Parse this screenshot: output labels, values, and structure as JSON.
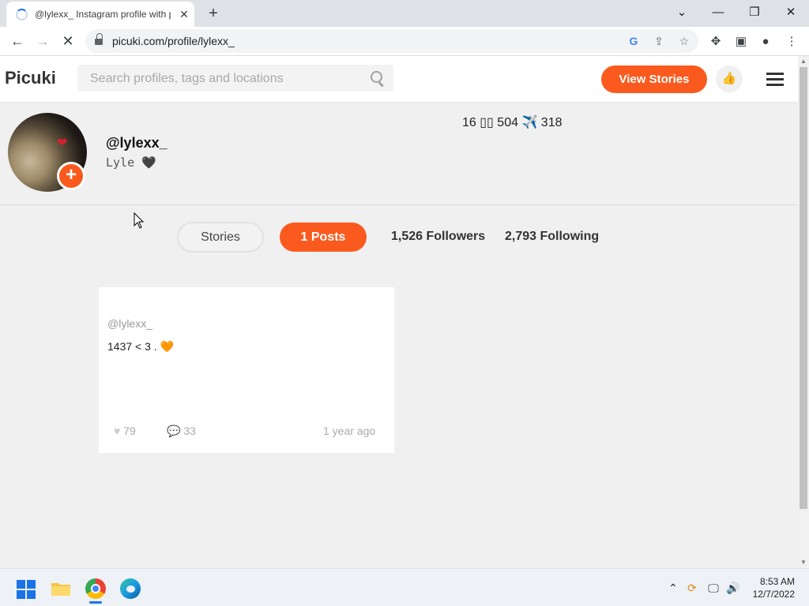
{
  "browser": {
    "tab_title": "@lylexx_ Instagram profile with p",
    "url": "picuki.com/profile/lylexx_",
    "new_tab_symbol": "+",
    "tab_close_symbol": "✕",
    "back_symbol": "←",
    "forward_symbol": "→",
    "stop_symbol": "✕"
  },
  "site": {
    "logo": "Picuki",
    "search_placeholder": "Search profiles, tags and locations",
    "view_stories_label": "View Stories",
    "accent_color": "#fa5a1e"
  },
  "profile": {
    "username": "@lylexx_",
    "full_name": "Lyle",
    "full_name_emoji": "🖤",
    "stats_line": "16 ▯▯ 504 ✈️ 318",
    "tabs": {
      "stories": "Stories",
      "posts": "1 Posts",
      "followers": "1,526 Followers",
      "following": "2,793 Following"
    }
  },
  "posts": [
    {
      "user": "@lylexx_",
      "caption": "1437 < 3 . ",
      "caption_emoji": "🧡",
      "likes": "79",
      "comments": "33",
      "time": "1 year ago"
    }
  ],
  "taskbar": {
    "time": "8:53 AM",
    "date": "12/7/2022"
  }
}
